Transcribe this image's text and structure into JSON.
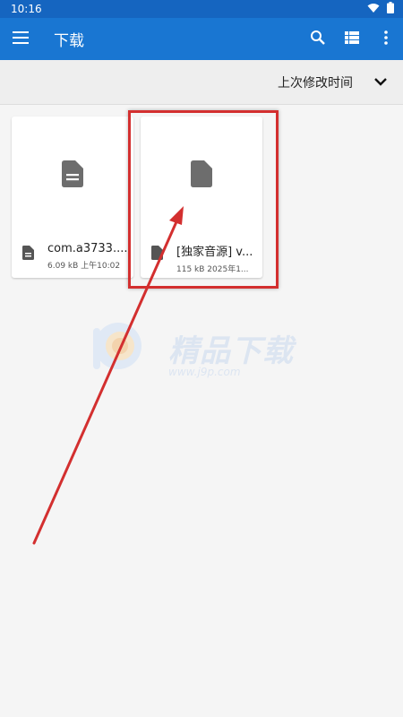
{
  "status_bar": {
    "time": "10:16"
  },
  "app_bar": {
    "title": "下载"
  },
  "sort_bar": {
    "label": "上次修改时间"
  },
  "files": [
    {
      "name": "com.a3733....",
      "meta": "6.09 kB 上午10:02"
    },
    {
      "name": "[独家音源] v...",
      "meta": "115 kB 2025年1..."
    }
  ],
  "watermark": {
    "brand": "精品下载",
    "url": "www.j9p.com"
  },
  "colors": {
    "app_bar": "#1976d2",
    "status_bar": "#1565c0",
    "highlight": "#d32f2f"
  }
}
